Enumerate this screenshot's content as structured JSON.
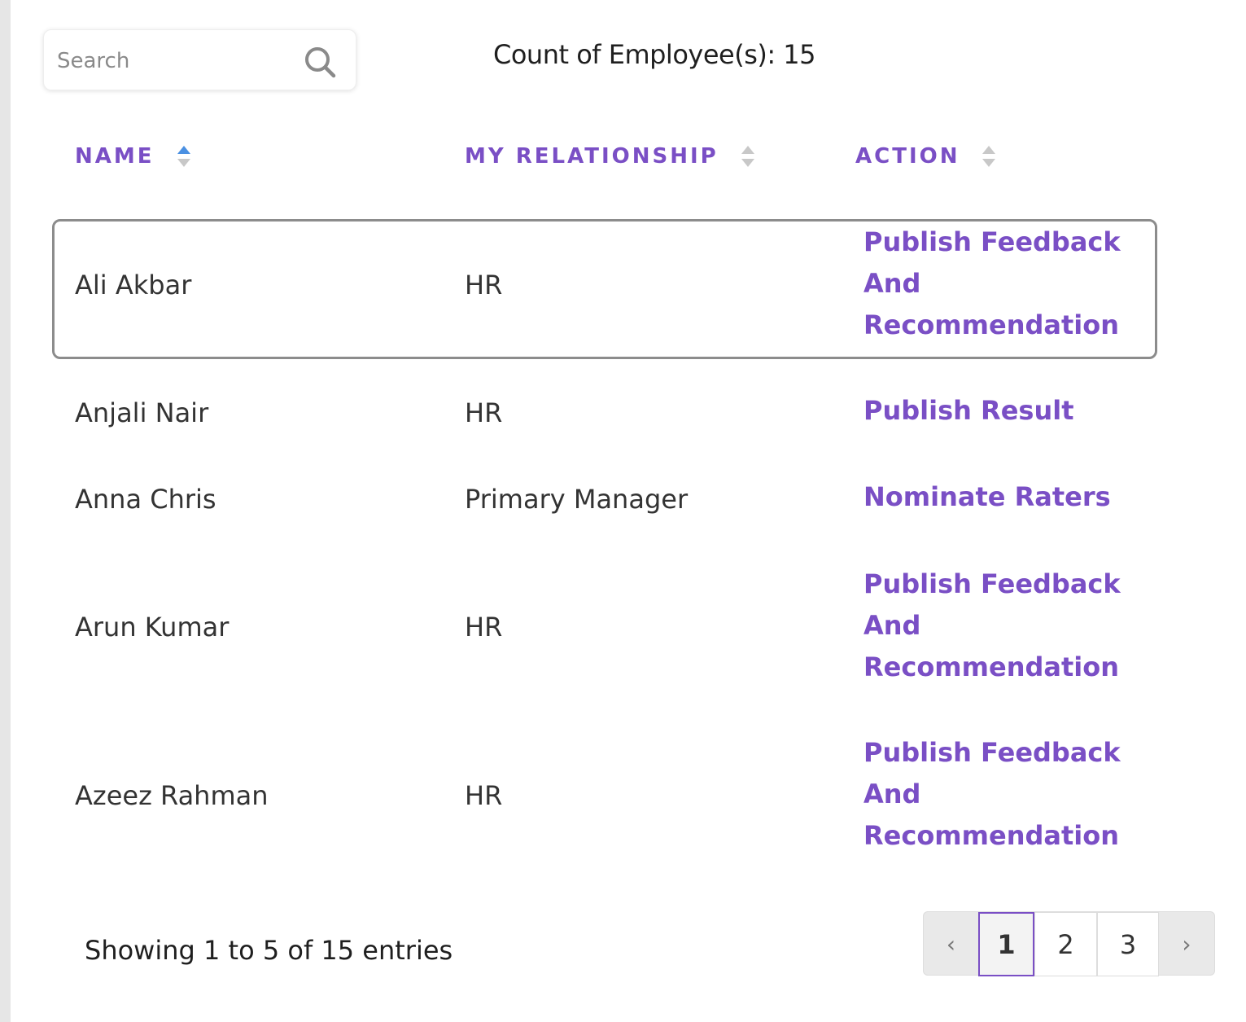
{
  "search": {
    "placeholder": "Search",
    "value": ""
  },
  "count_label": "Count of Employee(s): 15",
  "columns": [
    {
      "label": "NAME",
      "sort": "ascending"
    },
    {
      "label": "MY RELATIONSHIP",
      "sort": "none"
    },
    {
      "label": "ACTION",
      "sort": "none"
    }
  ],
  "rows": [
    {
      "name": "Ali Akbar",
      "relationship": "HR",
      "action": "Publish Feedback And Recommendation",
      "action_lines": [
        "Publish Feedback",
        "And",
        "Recommendation"
      ]
    },
    {
      "name": "Anjali Nair",
      "relationship": "HR",
      "action": "Publish Result",
      "action_lines": [
        "Publish Result"
      ]
    },
    {
      "name": "Anna Chris",
      "relationship": "Primary Manager",
      "action": "Nominate Raters",
      "action_lines": [
        "Nominate Raters"
      ]
    },
    {
      "name": "Arun Kumar",
      "relationship": "HR",
      "action": "Publish Feedback And Recommendation",
      "action_lines": [
        "Publish Feedback",
        "And",
        "Recommendation"
      ]
    },
    {
      "name": "Azeez Rahman",
      "relationship": "HR",
      "action": "Publish Feedback And Recommendation",
      "action_lines": [
        "Publish Feedback",
        "And",
        "Recommendation"
      ]
    }
  ],
  "footer": {
    "showing": "Showing 1 to 5 of 15 entries"
  },
  "pagination": {
    "prev": "‹",
    "pages": [
      "1",
      "2",
      "3"
    ],
    "current": "1",
    "next": "›"
  },
  "colors": {
    "accent": "#7a4fc5",
    "sort_active": "#4a90e2",
    "sort_inactive": "#c8c8c8"
  }
}
